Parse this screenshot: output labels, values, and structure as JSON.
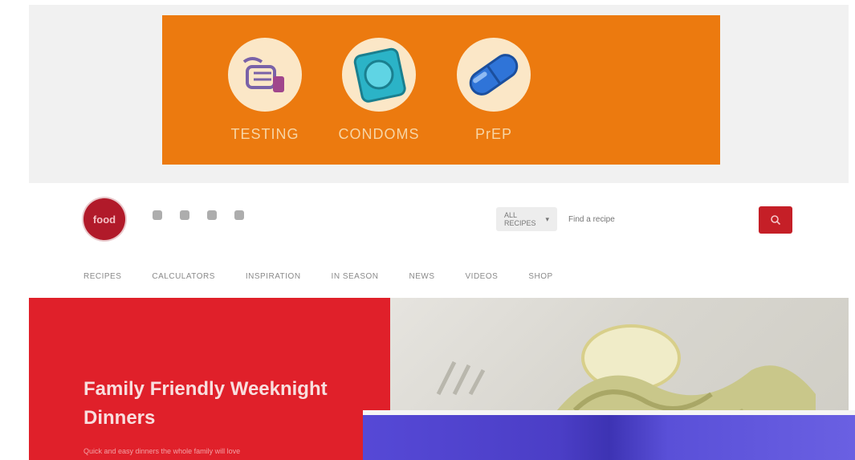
{
  "ad": {
    "items": [
      {
        "label": "TESTING",
        "icon": "testing-icon"
      },
      {
        "label": "CONDOMS",
        "icon": "condom-icon"
      },
      {
        "label": "PrEP",
        "icon": "pill-icon"
      }
    ],
    "background": "#ec7a0f"
  },
  "header": {
    "logo_text": "food",
    "social": [
      "facebook-icon",
      "pinterest-icon",
      "twitter-icon",
      "instagram-icon"
    ],
    "search": {
      "category": "ALL RECIPES",
      "placeholder": "Find a recipe"
    }
  },
  "nav": {
    "items": [
      "RECIPES",
      "CALCULATORS",
      "INSPIRATION",
      "IN SEASON",
      "NEWS",
      "VIDEOS",
      "SHOP"
    ]
  },
  "hero": {
    "title": "Family Friendly Weeknight Dinners",
    "subtitle": "Quick and easy dinners the whole family will love"
  },
  "colors": {
    "brand_red": "#c51f27",
    "hero_red": "#e0202a"
  }
}
